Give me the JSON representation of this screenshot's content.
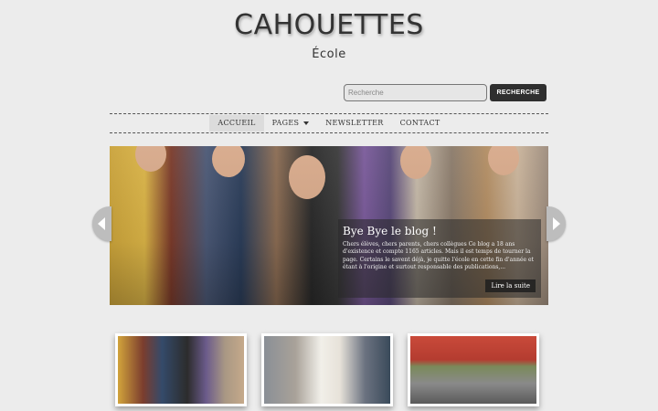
{
  "site": {
    "title": "CAHOUETTES",
    "subtitle": "École"
  },
  "search": {
    "placeholder": "Recherche",
    "value": "",
    "button_label": "RECHERCHE"
  },
  "nav": {
    "items": [
      {
        "label": "ACCUEIL",
        "active": true
      },
      {
        "label": "PAGES",
        "has_dropdown": true
      },
      {
        "label": "NEWSLETTER"
      },
      {
        "label": "CONTACT"
      }
    ]
  },
  "slider": {
    "caption_title": "Bye Bye le blog !",
    "caption_text": "Chers élèves, chers parents, chers collègues Ce blog a 18 ans d'existence et compte 1165 articles. Mais il est temps de tourner la page. Certains le savent déjà, je quitte l'école en cette fin d'année et étant à l'origine et surtout responsable des publications,...",
    "read_more_label": "Lire la suite",
    "prev_icon": "chevron-left-icon",
    "next_icon": "chevron-right-icon"
  },
  "colors": {
    "background": "#ececec",
    "dark": "#2f2f2f",
    "text": "#333333"
  }
}
